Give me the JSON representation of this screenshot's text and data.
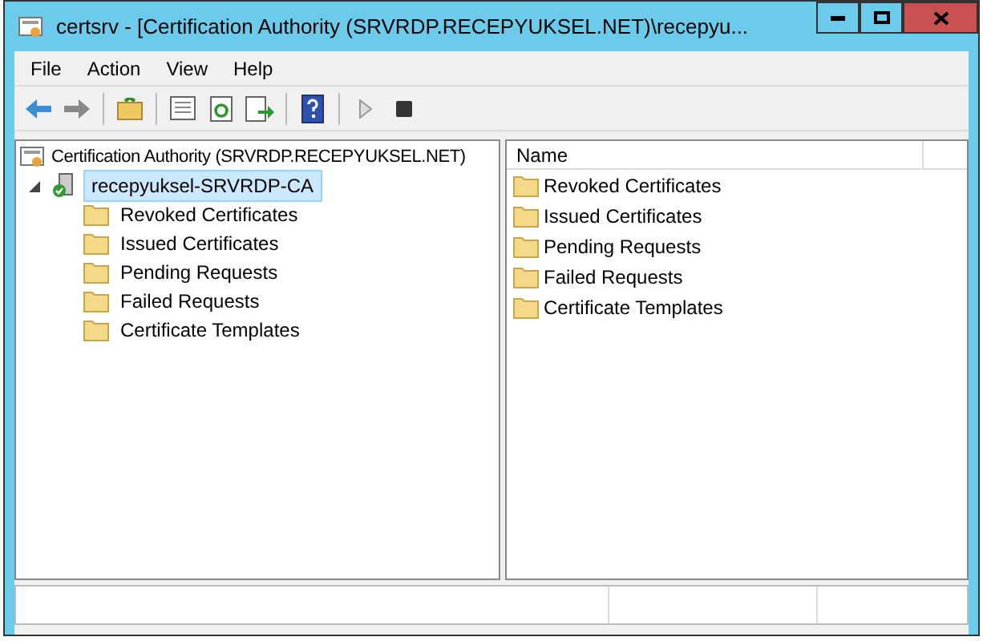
{
  "window": {
    "title": "certsrv - [Certification Authority (SRVRDP.RECEPYUKSEL.NET)\\recepyu..."
  },
  "menu": [
    "File",
    "Action",
    "View",
    "Help"
  ],
  "tree": {
    "label": "Certification Authority (SRVRDP.RECEPYUKSEL.NET)",
    "children": [
      {
        "label": "recepyuksel-SRVRDP-CA",
        "expanded": true,
        "selected": true,
        "children": [
          {
            "label": "Revoked Certificates",
            "selected": false
          },
          {
            "label": "Issued Certificates",
            "selected": false
          },
          {
            "label": "Pending Requests",
            "selected": false
          },
          {
            "label": "Failed Requests",
            "selected": false
          },
          {
            "label": "Certificate Templates",
            "selected": false
          }
        ]
      }
    ]
  },
  "list": {
    "columns": [
      "Name"
    ],
    "rows": [
      {
        "name": "Revoked Certificates"
      },
      {
        "name": "Issued Certificates"
      },
      {
        "name": "Pending Requests"
      },
      {
        "name": "Failed Requests"
      },
      {
        "name": "Certificate Templates"
      }
    ]
  }
}
